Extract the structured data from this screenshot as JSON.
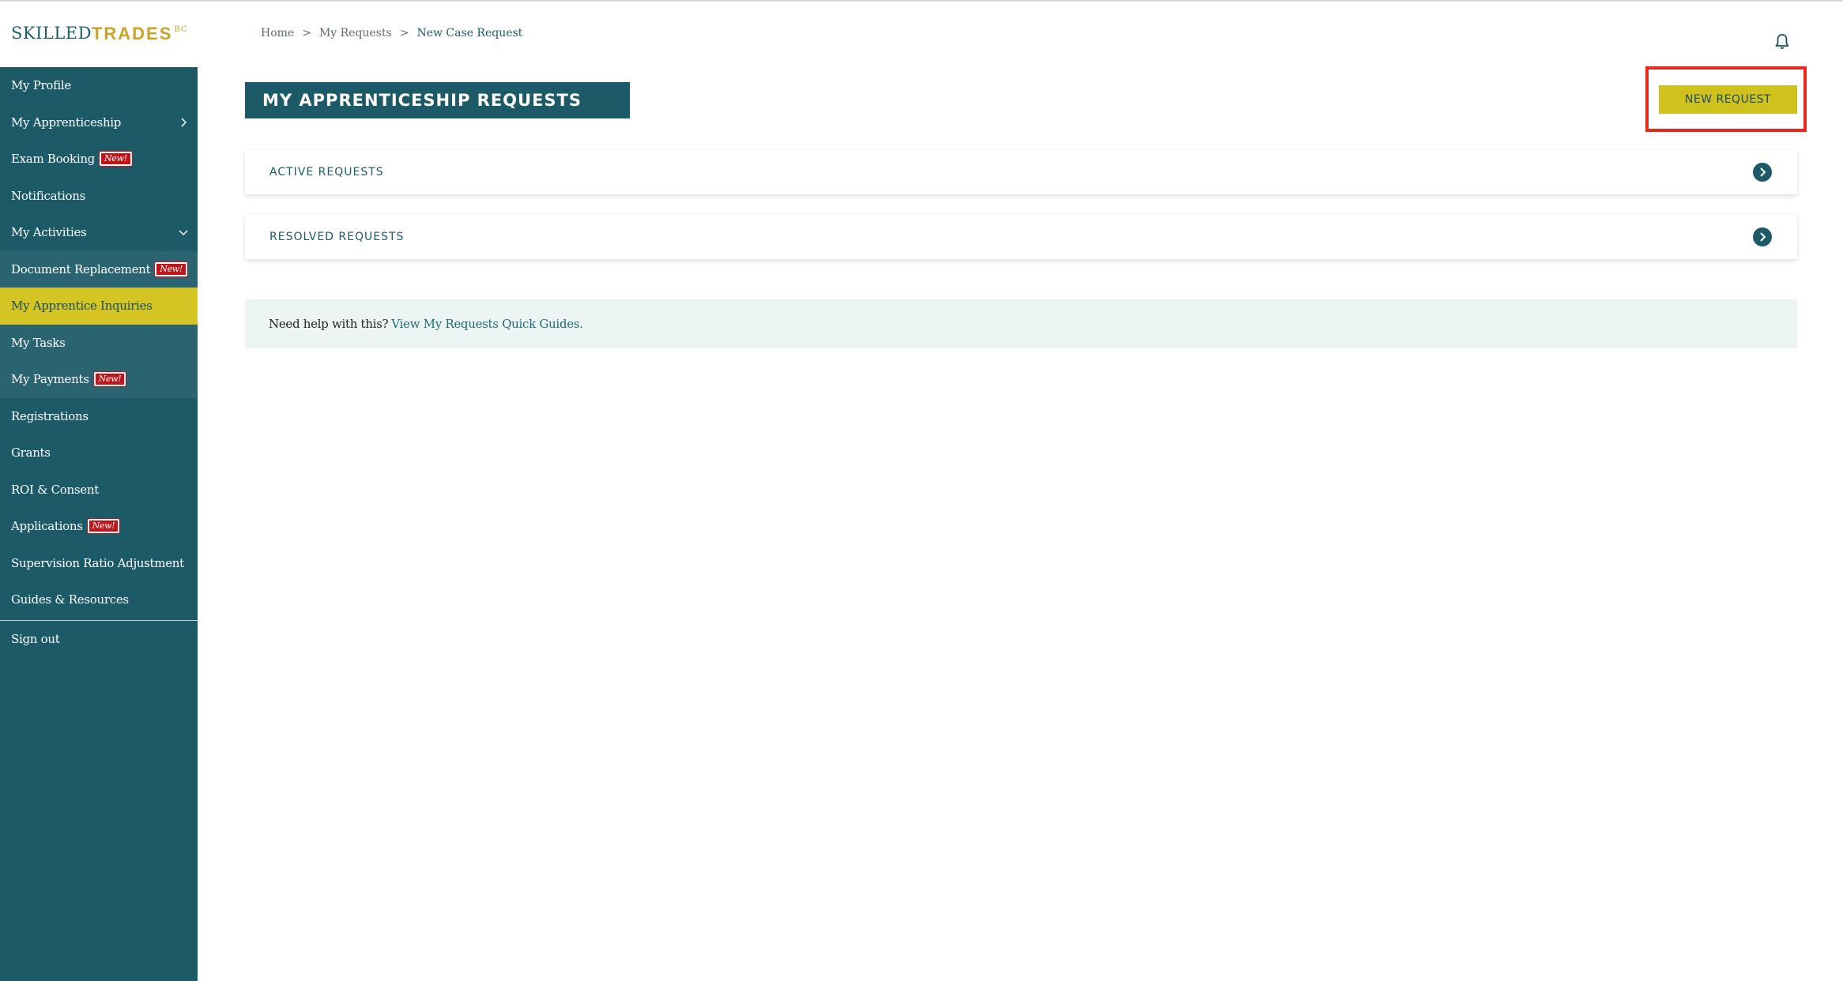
{
  "logo": {
    "skilled": "SKILLED",
    "trades": "TRADES",
    "bc": "BC"
  },
  "breadcrumb": {
    "home": "Home",
    "sep1": ">",
    "my_requests": "My Requests",
    "sep2": ">",
    "current": "New Case Request"
  },
  "sidebar": {
    "items": [
      {
        "label": "My Profile"
      },
      {
        "label": "My Apprenticeship"
      },
      {
        "label": "Exam Booking",
        "badge": "New!"
      },
      {
        "label": "Notifications"
      },
      {
        "label": "My Activities"
      },
      {
        "label": "Document Replacement",
        "badge": "New!"
      },
      {
        "label": "My Apprentice Inquiries"
      },
      {
        "label": "My Tasks"
      },
      {
        "label": "My Payments",
        "badge": "New!"
      },
      {
        "label": "Registrations"
      },
      {
        "label": "Grants"
      },
      {
        "label": "ROI & Consent"
      },
      {
        "label": "Applications",
        "badge": "New!"
      },
      {
        "label": "Supervision Ratio Adjustment"
      },
      {
        "label": "Guides & Resources"
      },
      {
        "label": "Sign out"
      }
    ]
  },
  "main": {
    "title": "MY APPRENTICESHIP REQUESTS",
    "new_request_label": "NEW REQUEST",
    "sections": [
      {
        "label": "ACTIVE REQUESTS"
      },
      {
        "label": "RESOLVED REQUESTS"
      }
    ],
    "help": {
      "text": "Need help with this?",
      "link": "View My Requests Quick Guides."
    }
  },
  "colors": {
    "sidebar": "#1c5a67",
    "accent": "#cfc21f",
    "badge": "#c0161b",
    "highlight": "#e8271d"
  }
}
